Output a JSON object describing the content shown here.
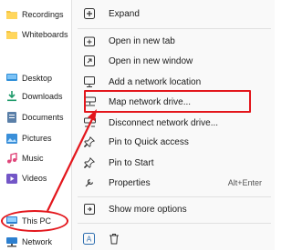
{
  "sidebar": {
    "items": [
      {
        "label": "Recordings",
        "icon": "folder-icon"
      },
      {
        "label": "Whiteboards",
        "icon": "folder-icon"
      },
      {
        "label": "Desktop",
        "icon": "desktop-icon"
      },
      {
        "label": "Downloads",
        "icon": "downloads-icon"
      },
      {
        "label": "Documents",
        "icon": "documents-icon"
      },
      {
        "label": "Pictures",
        "icon": "pictures-icon"
      },
      {
        "label": "Music",
        "icon": "music-icon"
      },
      {
        "label": "Videos",
        "icon": "videos-icon"
      },
      {
        "label": "This PC",
        "icon": "this-pc-icon"
      },
      {
        "label": "Network",
        "icon": "network-icon"
      }
    ]
  },
  "context_menu": {
    "items": [
      {
        "label": "Expand",
        "icon": "expand-icon",
        "shortcut": ""
      },
      {
        "label": "Open in new tab",
        "icon": "new-tab-icon",
        "shortcut": ""
      },
      {
        "label": "Open in new window",
        "icon": "new-window-icon",
        "shortcut": ""
      },
      {
        "label": "Add a network location",
        "icon": "network-location-icon",
        "shortcut": ""
      },
      {
        "label": "Map network drive...",
        "icon": "map-drive-icon",
        "shortcut": ""
      },
      {
        "label": "Disconnect network drive...",
        "icon": "disconnect-drive-icon",
        "shortcut": ""
      },
      {
        "label": "Pin to Quick access",
        "icon": "pin-icon",
        "shortcut": ""
      },
      {
        "label": "Pin to Start",
        "icon": "pin-icon",
        "shortcut": ""
      },
      {
        "label": "Properties",
        "icon": "properties-icon",
        "shortcut": "Alt+Enter"
      },
      {
        "label": "Show more options",
        "icon": "more-options-icon",
        "shortcut": ""
      }
    ],
    "bottom_icons": [
      "rename-icon",
      "delete-icon"
    ]
  },
  "annotation": {
    "highlight_color": "#e3161c",
    "highlighted_item": "Map network drive...",
    "circled_item": "This PC"
  }
}
